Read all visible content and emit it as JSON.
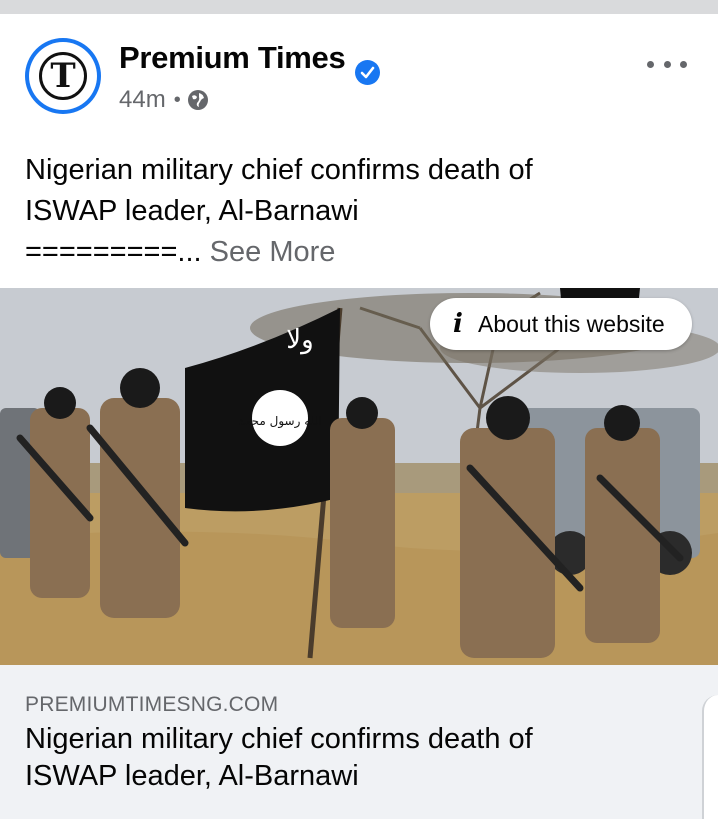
{
  "post": {
    "page_name": "Premium Times",
    "time": "44m",
    "separator": "•",
    "text_line1": "Nigerian military chief confirms death of",
    "text_line2": "ISWAP leader, Al-Barnawi",
    "text_line3": "=========...",
    "see_more": "See More"
  },
  "avatar": {
    "letter": "T"
  },
  "image": {
    "about_label": "About this website",
    "flag_text": "ولا",
    "seal_text": "الله رسول محمد"
  },
  "link": {
    "domain": "PREMIUMTIMESNG.COM",
    "title_line1": "Nigerian military chief confirms death of",
    "title_line2": "ISWAP leader, Al-Barnawi"
  },
  "icons": {
    "verified": "verified-badge-icon",
    "globe": "globe-icon",
    "more": "more-options-icon",
    "info": "info-icon"
  },
  "colors": {
    "accent": "#1877f2",
    "text_primary": "#050505",
    "text_secondary": "#65676b",
    "link_bg": "#f0f2f5"
  }
}
